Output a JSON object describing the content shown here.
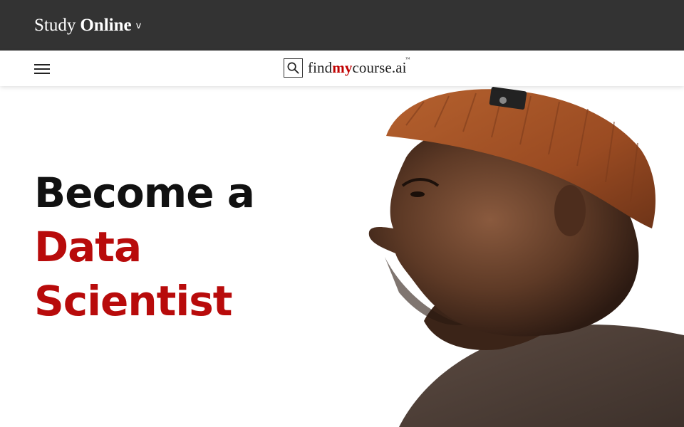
{
  "header": {
    "brand_light": "Study",
    "brand_bold": "Online",
    "caret": "v"
  },
  "nav": {
    "menu_icon": "hamburger-menu-icon",
    "logo": {
      "icon": "search-icon",
      "prefix": "find",
      "highlight": "my",
      "suffix": "course.ai",
      "trademark": "™"
    }
  },
  "hero": {
    "line1": "Become a",
    "line2": "Data",
    "line3": "Scientist",
    "image": "man-in-orange-beanie-portrait"
  },
  "colors": {
    "topbar": "#333333",
    "accent_red": "#b80b0b",
    "text_dark": "#111111"
  }
}
